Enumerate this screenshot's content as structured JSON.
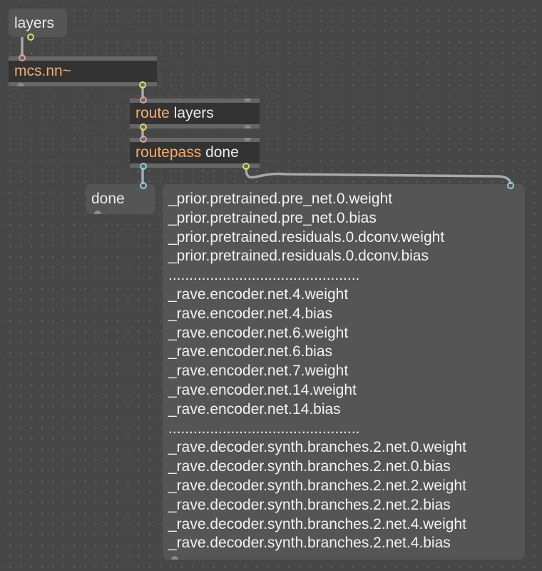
{
  "layers_message": "layers",
  "nn_object": "mcs.nn~",
  "route_object": {
    "keyword": "route",
    "arg": "layers"
  },
  "routepass_object": {
    "keyword": "routepass",
    "arg": "done"
  },
  "done_message": "done",
  "layer_lines": [
    "_prior.pretrained.pre_net.0.weight",
    "_prior.pretrained.pre_net.0.bias",
    "_prior.pretrained.residuals.0.dconv.weight",
    "_prior.pretrained.residuals.0.dconv.bias",
    "..............................................",
    "_rave.encoder.net.4.weight",
    "_rave.encoder.net.4.bias",
    "_rave.encoder.net.6.weight",
    "_rave.encoder.net.6.bias",
    "_rave.encoder.net.7.weight",
    "_rave.encoder.net.14.weight",
    "_rave.encoder.net.14.bias",
    "..............................................",
    "_rave.decoder.synth.branches.2.net.0.weight",
    "_rave.decoder.synth.branches.2.net.0.bias",
    "_rave.decoder.synth.branches.2.net.2.weight",
    "_rave.decoder.synth.branches.2.net.2.bias",
    "_rave.decoder.synth.branches.2.net.4.weight",
    "_rave.decoder.synth.branches.2.net.4.bias"
  ],
  "colors": {
    "canvas": "#474747",
    "object_fill": "#333333",
    "message_fill": "#555555",
    "keyword_orange": "#f7ad6c",
    "patch_cord": "#a8a8a8"
  }
}
